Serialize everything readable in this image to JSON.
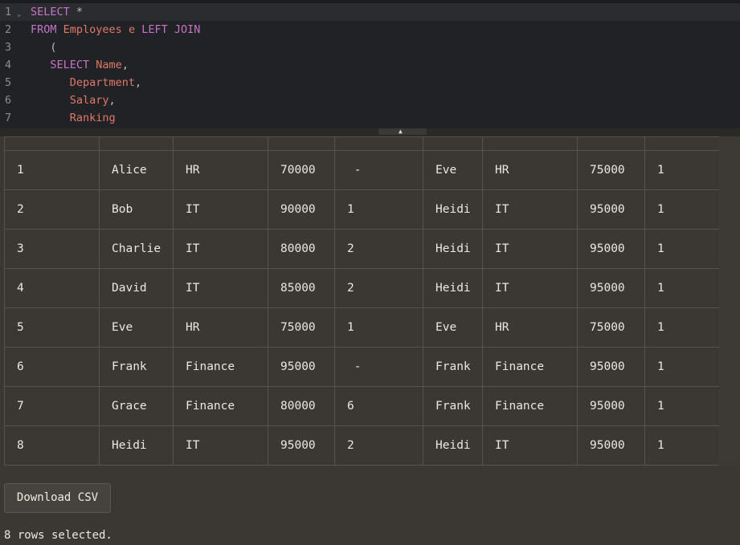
{
  "editor": {
    "lines": [
      {
        "num": "1",
        "tokens": [
          [
            "kw",
            "SELECT"
          ],
          [
            "punct",
            " "
          ],
          [
            "punct",
            "*"
          ]
        ]
      },
      {
        "num": "2",
        "tokens": [
          [
            "kw",
            "FROM"
          ],
          [
            "punct",
            " "
          ],
          [
            "ident",
            "Employees"
          ],
          [
            "punct",
            " "
          ],
          [
            "ident",
            "e"
          ],
          [
            "punct",
            " "
          ],
          [
            "kw",
            "LEFT"
          ],
          [
            "punct",
            " "
          ],
          [
            "kw",
            "JOIN"
          ]
        ]
      },
      {
        "num": "3",
        "tokens": [
          [
            "punct",
            "   ("
          ]
        ]
      },
      {
        "num": "4",
        "tokens": [
          [
            "kw",
            "   SELECT"
          ],
          [
            "punct",
            " "
          ],
          [
            "ident",
            "Name"
          ],
          [
            "punct",
            ","
          ]
        ]
      },
      {
        "num": "5",
        "tokens": [
          [
            "ident",
            "      Department"
          ],
          [
            "punct",
            ","
          ]
        ]
      },
      {
        "num": "6",
        "tokens": [
          [
            "ident",
            "      Salary"
          ],
          [
            "punct",
            ","
          ]
        ]
      },
      {
        "num": "7",
        "tokens": [
          [
            "ident",
            "      Ranking"
          ]
        ]
      }
    ],
    "fold_icon": "chevron-down-icon"
  },
  "results": {
    "headers": [
      "",
      "",
      "",
      "",
      "",
      "",
      "",
      "",
      ""
    ],
    "rows": [
      [
        "1",
        "Alice",
        "HR",
        "70000",
        " -",
        "Eve",
        "HR",
        "75000",
        "1"
      ],
      [
        "2",
        "Bob",
        "IT",
        "90000",
        "1",
        "Heidi",
        "IT",
        "95000",
        "1"
      ],
      [
        "3",
        "Charlie",
        "IT",
        "80000",
        "2",
        "Heidi",
        "IT",
        "95000",
        "1"
      ],
      [
        "4",
        "David",
        "IT",
        "85000",
        "2",
        "Heidi",
        "IT",
        "95000",
        "1"
      ],
      [
        "5",
        "Eve",
        "HR",
        "75000",
        "1",
        "Eve",
        "HR",
        "75000",
        "1"
      ],
      [
        "6",
        "Frank",
        "Finance",
        "95000",
        " -",
        "Frank",
        "Finance",
        "95000",
        "1"
      ],
      [
        "7",
        "Grace",
        "Finance",
        "80000",
        "6",
        "Frank",
        "Finance",
        "95000",
        "1"
      ],
      [
        "8",
        "Heidi",
        "IT",
        "95000",
        "2",
        "Heidi",
        "IT",
        "95000",
        "1"
      ]
    ]
  },
  "footer": {
    "download_label": "Download CSV",
    "status_text": "8 rows selected."
  },
  "colors": {
    "keyword": "#c873c9",
    "identifier": "#e0786a",
    "background": "#3b3732",
    "editor_bg": "#212225"
  }
}
